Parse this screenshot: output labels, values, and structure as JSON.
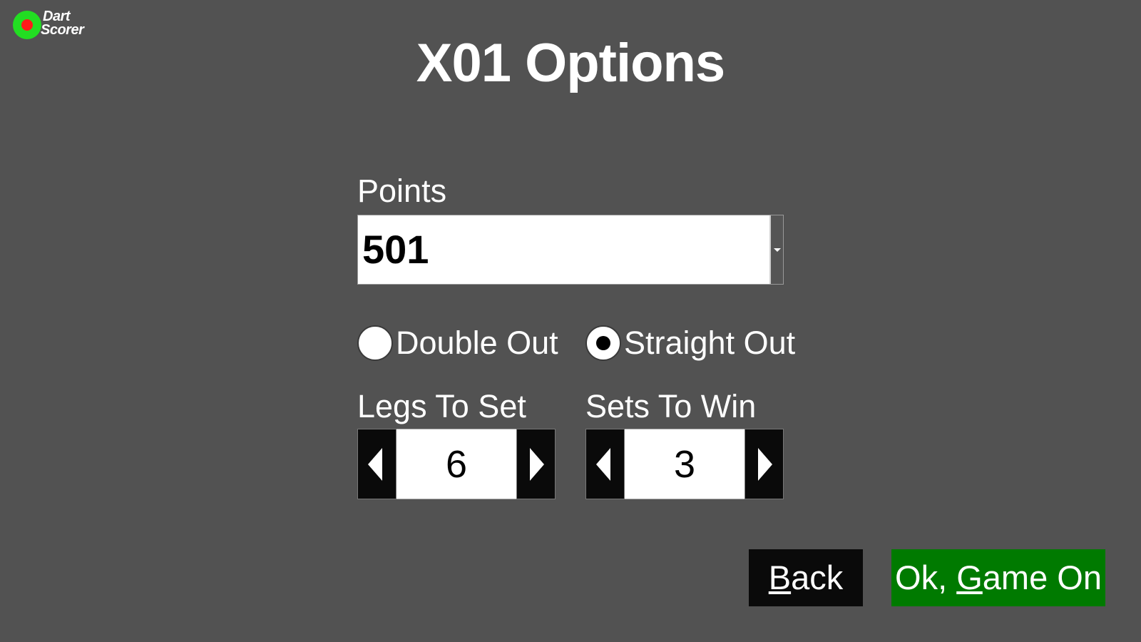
{
  "app": {
    "logo_line1": "Dart",
    "logo_line2": "Scorer",
    "logo_colors": {
      "ring": "#22dd22",
      "center": "#ff1a1a"
    }
  },
  "page": {
    "title": "X01 Options",
    "background": "#525252"
  },
  "points": {
    "label": "Points",
    "selected_value": "501"
  },
  "finish_mode": {
    "options": [
      {
        "label": "Double Out",
        "selected": false
      },
      {
        "label": "Straight Out",
        "selected": true
      }
    ]
  },
  "legs_to_set": {
    "label": "Legs To Set",
    "value": "6"
  },
  "sets_to_win": {
    "label": "Sets To Win",
    "value": "3"
  },
  "actions": {
    "back": {
      "mnemonic": "B",
      "rest": "ack",
      "color": "#0a0a0a"
    },
    "ok": {
      "prefix": "Ok, ",
      "mnemonic": "G",
      "rest": "ame On",
      "color": "#007a00"
    }
  },
  "icons": {
    "points_dropdown": "chevron-down-icon",
    "decrement": "triangle-left-icon",
    "increment": "triangle-right-icon"
  }
}
